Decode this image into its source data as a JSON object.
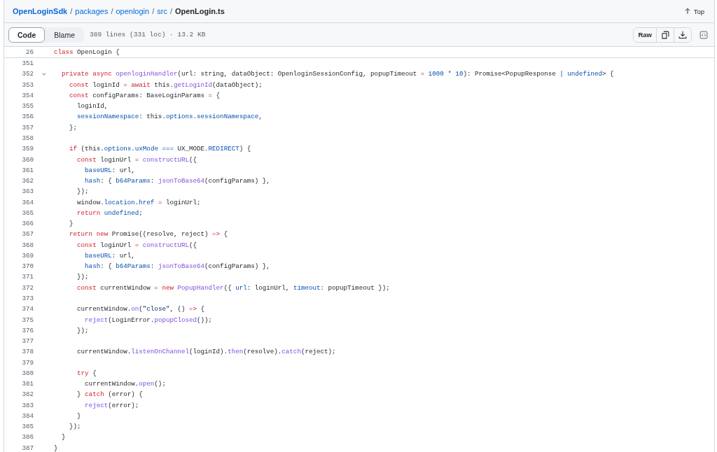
{
  "breadcrumb": {
    "parts": [
      "OpenLoginSdk",
      "packages",
      "openlogin",
      "src"
    ],
    "separator": "/",
    "file": "OpenLogin.ts"
  },
  "top_link": {
    "label": "Top"
  },
  "view_tabs": [
    {
      "label": "Code",
      "selected": true
    },
    {
      "label": "Blame",
      "selected": false
    }
  ],
  "file_info": "389 lines (331 loc) · 13.2 KB",
  "raw_button": {
    "label": "Raw"
  },
  "sticky_line": {
    "number": "26",
    "tokens": [
      {
        "kind": "kw",
        "text": "class"
      },
      {
        "kind": "text",
        "text": " OpenLogin {"
      }
    ]
  },
  "lines": [
    {
      "number": "351",
      "fold": false
    },
    {
      "number": "352",
      "fold": true,
      "tokens": [
        {
          "kind": "kw",
          "text": "  private async"
        },
        {
          "kind": "fn",
          "text": " openloginHandler"
        },
        {
          "kind": "text",
          "text": "(url: string, dataObject: OpenloginSessionConfig, popupTimeout "
        },
        {
          "kind": "kw",
          "text": "="
        },
        {
          "kind": "c",
          "text": " 1000 * 10"
        },
        {
          "kind": "text",
          "text": "): Promise<PopupResponse "
        },
        {
          "kind": "c",
          "text": "| undefined"
        },
        {
          "kind": "text",
          "text": "> {"
        }
      ]
    },
    {
      "number": "353",
      "fold": false,
      "tokens": [
        {
          "kind": "kw",
          "text": "    const"
        },
        {
          "kind": "text",
          "text": " loginId "
        },
        {
          "kind": "kw",
          "text": "= await"
        },
        {
          "kind": "text",
          "text": " this."
        },
        {
          "kind": "fn",
          "text": "getLoginId"
        },
        {
          "kind": "text",
          "text": "(dataObject);"
        }
      ]
    },
    {
      "number": "354",
      "fold": false,
      "tokens": [
        {
          "kind": "kw",
          "text": "    const"
        },
        {
          "kind": "text",
          "text": " configParams: BaseLoginParams "
        },
        {
          "kind": "kw",
          "text": "="
        },
        {
          "kind": "text",
          "text": " {"
        }
      ]
    },
    {
      "number": "355",
      "fold": false,
      "tokens": [
        {
          "kind": "text",
          "text": "      loginId,"
        }
      ]
    },
    {
      "number": "356",
      "fold": false,
      "tokens": [
        {
          "kind": "c",
          "text": "      sessionNamespace"
        },
        {
          "kind": "text",
          "text": ": this."
        },
        {
          "kind": "c",
          "text": "options"
        },
        {
          "kind": "text",
          "text": "."
        },
        {
          "kind": "c",
          "text": "sessionNamespace"
        },
        {
          "kind": "text",
          "text": ","
        }
      ]
    },
    {
      "number": "357",
      "fold": false,
      "tokens": [
        {
          "kind": "text",
          "text": "    };"
        }
      ]
    },
    {
      "number": "358",
      "fold": false
    },
    {
      "number": "359",
      "fold": false,
      "tokens": [
        {
          "kind": "kw",
          "text": "    if"
        },
        {
          "kind": "text",
          "text": " (this."
        },
        {
          "kind": "c",
          "text": "options"
        },
        {
          "kind": "text",
          "text": "."
        },
        {
          "kind": "c",
          "text": "uxMode ==="
        },
        {
          "kind": "text",
          "text": " UX_MODE."
        },
        {
          "kind": "c",
          "text": "REDIRECT"
        },
        {
          "kind": "text",
          "text": ") {"
        }
      ]
    },
    {
      "number": "360",
      "fold": false,
      "tokens": [
        {
          "kind": "kw",
          "text": "      const"
        },
        {
          "kind": "text",
          "text": " loginUrl "
        },
        {
          "kind": "kw",
          "text": "="
        },
        {
          "kind": "fn",
          "text": " constructURL"
        },
        {
          "kind": "text",
          "text": "({"
        }
      ]
    },
    {
      "number": "361",
      "fold": false,
      "tokens": [
        {
          "kind": "c",
          "text": "        baseURL"
        },
        {
          "kind": "text",
          "text": ": url,"
        }
      ]
    },
    {
      "number": "362",
      "fold": false,
      "tokens": [
        {
          "kind": "c",
          "text": "        hash"
        },
        {
          "kind": "text",
          "text": ": { "
        },
        {
          "kind": "c",
          "text": "b64Params"
        },
        {
          "kind": "text",
          "text": ": "
        },
        {
          "kind": "fn",
          "text": "jsonToBase64"
        },
        {
          "kind": "text",
          "text": "(configParams) },"
        }
      ]
    },
    {
      "number": "363",
      "fold": false,
      "tokens": [
        {
          "kind": "text",
          "text": "      });"
        }
      ]
    },
    {
      "number": "364",
      "fold": false,
      "tokens": [
        {
          "kind": "text",
          "text": "      window."
        },
        {
          "kind": "c",
          "text": "location"
        },
        {
          "kind": "text",
          "text": "."
        },
        {
          "kind": "c",
          "text": "href"
        },
        {
          "kind": "kw",
          "text": " ="
        },
        {
          "kind": "text",
          "text": " loginUrl;"
        }
      ]
    },
    {
      "number": "365",
      "fold": false,
      "tokens": [
        {
          "kind": "kw",
          "text": "      return"
        },
        {
          "kind": "c",
          "text": " undefined"
        },
        {
          "kind": "text",
          "text": ";"
        }
      ]
    },
    {
      "number": "366",
      "fold": false,
      "tokens": [
        {
          "kind": "text",
          "text": "    }"
        }
      ]
    },
    {
      "number": "367",
      "fold": false,
      "tokens": [
        {
          "kind": "kw",
          "text": "    return new"
        },
        {
          "kind": "text",
          "text": " Promise((resolve, reject) "
        },
        {
          "kind": "kw",
          "text": "=>"
        },
        {
          "kind": "text",
          "text": " {"
        }
      ]
    },
    {
      "number": "368",
      "fold": false,
      "tokens": [
        {
          "kind": "kw",
          "text": "      const"
        },
        {
          "kind": "text",
          "text": " loginUrl "
        },
        {
          "kind": "kw",
          "text": "="
        },
        {
          "kind": "fn",
          "text": " constructURL"
        },
        {
          "kind": "text",
          "text": "({"
        }
      ]
    },
    {
      "number": "369",
      "fold": false,
      "tokens": [
        {
          "kind": "c",
          "text": "        baseURL"
        },
        {
          "kind": "text",
          "text": ": url,"
        }
      ]
    },
    {
      "number": "370",
      "fold": false,
      "tokens": [
        {
          "kind": "c",
          "text": "        hash"
        },
        {
          "kind": "text",
          "text": ": { "
        },
        {
          "kind": "c",
          "text": "b64Params"
        },
        {
          "kind": "text",
          "text": ": "
        },
        {
          "kind": "fn",
          "text": "jsonToBase64"
        },
        {
          "kind": "text",
          "text": "(configParams) },"
        }
      ]
    },
    {
      "number": "371",
      "fold": false,
      "tokens": [
        {
          "kind": "text",
          "text": "      });"
        }
      ]
    },
    {
      "number": "372",
      "fold": false,
      "tokens": [
        {
          "kind": "kw",
          "text": "      const"
        },
        {
          "kind": "text",
          "text": " currentWindow "
        },
        {
          "kind": "kw",
          "text": "= new"
        },
        {
          "kind": "fn",
          "text": " PopupHandler"
        },
        {
          "kind": "text",
          "text": "({ "
        },
        {
          "kind": "c",
          "text": "url"
        },
        {
          "kind": "text",
          "text": ": loginUrl, "
        },
        {
          "kind": "c",
          "text": "timeout"
        },
        {
          "kind": "text",
          "text": ": popupTimeout });"
        }
      ]
    },
    {
      "number": "373",
      "fold": false
    },
    {
      "number": "374",
      "fold": false,
      "tokens": [
        {
          "kind": "text",
          "text": "      currentWindow."
        },
        {
          "kind": "fn",
          "text": "on"
        },
        {
          "kind": "text",
          "text": "("
        },
        {
          "kind": "str",
          "text": "\"close\""
        },
        {
          "kind": "text",
          "text": ", () "
        },
        {
          "kind": "kw",
          "text": "=>"
        },
        {
          "kind": "text",
          "text": " {"
        }
      ]
    },
    {
      "number": "375",
      "fold": false,
      "tokens": [
        {
          "kind": "fn",
          "text": "        reject"
        },
        {
          "kind": "text",
          "text": "(LoginError."
        },
        {
          "kind": "fn",
          "text": "popupClosed"
        },
        {
          "kind": "text",
          "text": "());"
        }
      ]
    },
    {
      "number": "376",
      "fold": false,
      "tokens": [
        {
          "kind": "text",
          "text": "      });"
        }
      ]
    },
    {
      "number": "377",
      "fold": false
    },
    {
      "number": "378",
      "fold": false,
      "tokens": [
        {
          "kind": "text",
          "text": "      currentWindow."
        },
        {
          "kind": "fn",
          "text": "listenOnChannel"
        },
        {
          "kind": "text",
          "text": "(loginId)."
        },
        {
          "kind": "fn",
          "text": "then"
        },
        {
          "kind": "text",
          "text": "(resolve)."
        },
        {
          "kind": "fn",
          "text": "catch"
        },
        {
          "kind": "text",
          "text": "(reject);"
        }
      ]
    },
    {
      "number": "379",
      "fold": false
    },
    {
      "number": "380",
      "fold": false,
      "tokens": [
        {
          "kind": "kw",
          "text": "      try"
        },
        {
          "kind": "text",
          "text": " {"
        }
      ]
    },
    {
      "number": "381",
      "fold": false,
      "tokens": [
        {
          "kind": "text",
          "text": "        currentWindow."
        },
        {
          "kind": "fn",
          "text": "open"
        },
        {
          "kind": "text",
          "text": "();"
        }
      ]
    },
    {
      "number": "382",
      "fold": false,
      "tokens": [
        {
          "kind": "text",
          "text": "      } "
        },
        {
          "kind": "kw",
          "text": "catch"
        },
        {
          "kind": "text",
          "text": " (error) {"
        }
      ]
    },
    {
      "number": "383",
      "fold": false,
      "tokens": [
        {
          "kind": "fn",
          "text": "        reject"
        },
        {
          "kind": "text",
          "text": "(error);"
        }
      ]
    },
    {
      "number": "384",
      "fold": false,
      "tokens": [
        {
          "kind": "text",
          "text": "      }"
        }
      ]
    },
    {
      "number": "385",
      "fold": false,
      "tokens": [
        {
          "kind": "text",
          "text": "    });"
        }
      ]
    },
    {
      "number": "386",
      "fold": false,
      "tokens": [
        {
          "kind": "text",
          "text": "  }"
        }
      ]
    },
    {
      "number": "387",
      "fold": false,
      "tokens": [
        {
          "kind": "text",
          "text": "}"
        }
      ]
    }
  ]
}
